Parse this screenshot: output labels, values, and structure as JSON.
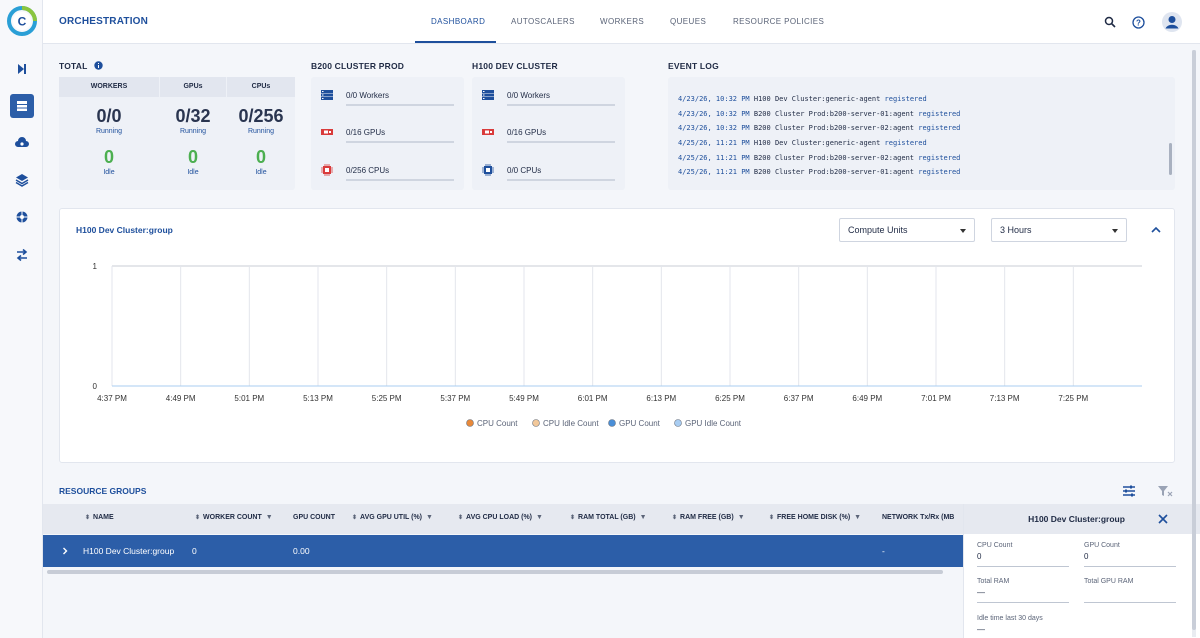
{
  "header": {
    "app_title": "ORCHESTRATION",
    "tabs": [
      {
        "label": "DASHBOARD"
      },
      {
        "label": "AUTOSCALERS"
      },
      {
        "label": "WORKERS"
      },
      {
        "label": "QUEUES"
      },
      {
        "label": "RESOURCE POLICIES"
      }
    ],
    "active_tab": "DASHBOARD",
    "icons": [
      "search-icon",
      "help-icon",
      "account-icon"
    ]
  },
  "sidebar": {
    "icons": [
      "expand-icon",
      "dashboard-icon",
      "cloud-icon",
      "layers-icon",
      "network-icon",
      "transfer-icon"
    ],
    "active_index": 1
  },
  "total": {
    "title": "TOTAL",
    "columns": [
      {
        "header": "WORKERS",
        "running": "0/0",
        "running_label": "Running",
        "idle": "0",
        "idle_label": "Idle"
      },
      {
        "header": "GPUs",
        "running": "0/32",
        "running_label": "Running",
        "idle": "0",
        "idle_label": "Idle"
      },
      {
        "header": "CPUs",
        "running": "0/256",
        "running_label": "Running",
        "idle": "0",
        "idle_label": "Idle"
      }
    ]
  },
  "clusters": [
    {
      "title": "B200 CLUSTER PROD",
      "workers": "0/0 Workers",
      "gpus": "0/16 GPUs",
      "cpus": "0/256 CPUs"
    },
    {
      "title": "H100 DEV CLUSTER",
      "workers": "0/0 Workers",
      "gpus": "0/16 GPUs",
      "cpus": "0/0 CPUs"
    }
  ],
  "event_log": {
    "title": "EVENT LOG",
    "entries": [
      {
        "ts": "4/23/26, 10:32 PM",
        "msg": "H100 Dev Cluster:generic-agent",
        "status": "registered"
      },
      {
        "ts": "4/23/26, 10:32 PM",
        "msg": "B200 Cluster Prod:b200-server-01:agent",
        "status": "registered"
      },
      {
        "ts": "4/23/26, 10:32 PM",
        "msg": "B200 Cluster Prod:b200-server-02:agent",
        "status": "registered"
      },
      {
        "ts": "4/25/26, 11:21 PM",
        "msg": "H100 Dev Cluster:generic-agent",
        "status": "registered"
      },
      {
        "ts": "4/25/26, 11:21 PM",
        "msg": "B200 Cluster Prod:b200-server-02:agent",
        "status": "registered"
      },
      {
        "ts": "4/25/26, 11:21 PM",
        "msg": "B200 Cluster Prod:b200-server-01:agent",
        "status": "registered"
      }
    ]
  },
  "chart_panel": {
    "title": "H100 Dev Cluster:group",
    "metric_select": "Compute Units",
    "range_select": "3 Hours"
  },
  "chart_data": {
    "type": "line",
    "title": "H100 Dev Cluster:group",
    "x": [
      "4:37 PM",
      "4:49 PM",
      "5:01 PM",
      "5:13 PM",
      "5:25 PM",
      "5:37 PM",
      "5:49 PM",
      "6:01 PM",
      "6:13 PM",
      "6:25 PM",
      "6:37 PM",
      "6:49 PM",
      "7:01 PM",
      "7:13 PM",
      "7:25 PM"
    ],
    "yticks": [
      "1",
      "0"
    ],
    "ylim": [
      0,
      1
    ],
    "series": [
      {
        "name": "CPU Count",
        "color": "#e8893a",
        "values": [
          0,
          0,
          0,
          0,
          0,
          0,
          0,
          0,
          0,
          0,
          0,
          0,
          0,
          0,
          0
        ]
      },
      {
        "name": "CPU Idle Count",
        "color": "#f2c89a",
        "values": [
          0,
          0,
          0,
          0,
          0,
          0,
          0,
          0,
          0,
          0,
          0,
          0,
          0,
          0,
          0
        ]
      },
      {
        "name": "GPU Count",
        "color": "#4a8fd8",
        "values": [
          0,
          0,
          0,
          0,
          0,
          0,
          0,
          0,
          0,
          0,
          0,
          0,
          0,
          0,
          0
        ]
      },
      {
        "name": "GPU Idle Count",
        "color": "#a9cdf2",
        "values": [
          0,
          0,
          0,
          0,
          0,
          0,
          0,
          0,
          0,
          0,
          0,
          0,
          0,
          0,
          0
        ]
      }
    ],
    "grid": true,
    "legend": "bottom"
  },
  "resource_groups": {
    "title": "RESOURCE GROUPS",
    "columns": [
      "NAME",
      "WORKER COUNT",
      "GPU COUNT",
      "AVG GPU UTIL (%)",
      "AVG CPU LOAD (%)",
      "RAM TOTAL (GB)",
      "RAM FREE (GB)",
      "FREE HOME DISK (%)",
      "NETWORK Tx/Rx (MB"
    ],
    "rows": [
      {
        "name": "H100 Dev Cluster:group",
        "worker_count": "0",
        "gpu_count": "0.00",
        "network": "-"
      }
    ]
  },
  "details": {
    "title": "H100 Dev Cluster:group",
    "fields": [
      {
        "label": "CPU Count",
        "value": "0"
      },
      {
        "label": "GPU Count",
        "value": "0"
      },
      {
        "label": "Total RAM",
        "value": "—"
      },
      {
        "label": "Total GPU RAM",
        "value": ""
      },
      {
        "label": "Idle time last 30 days",
        "value": "—"
      }
    ]
  }
}
